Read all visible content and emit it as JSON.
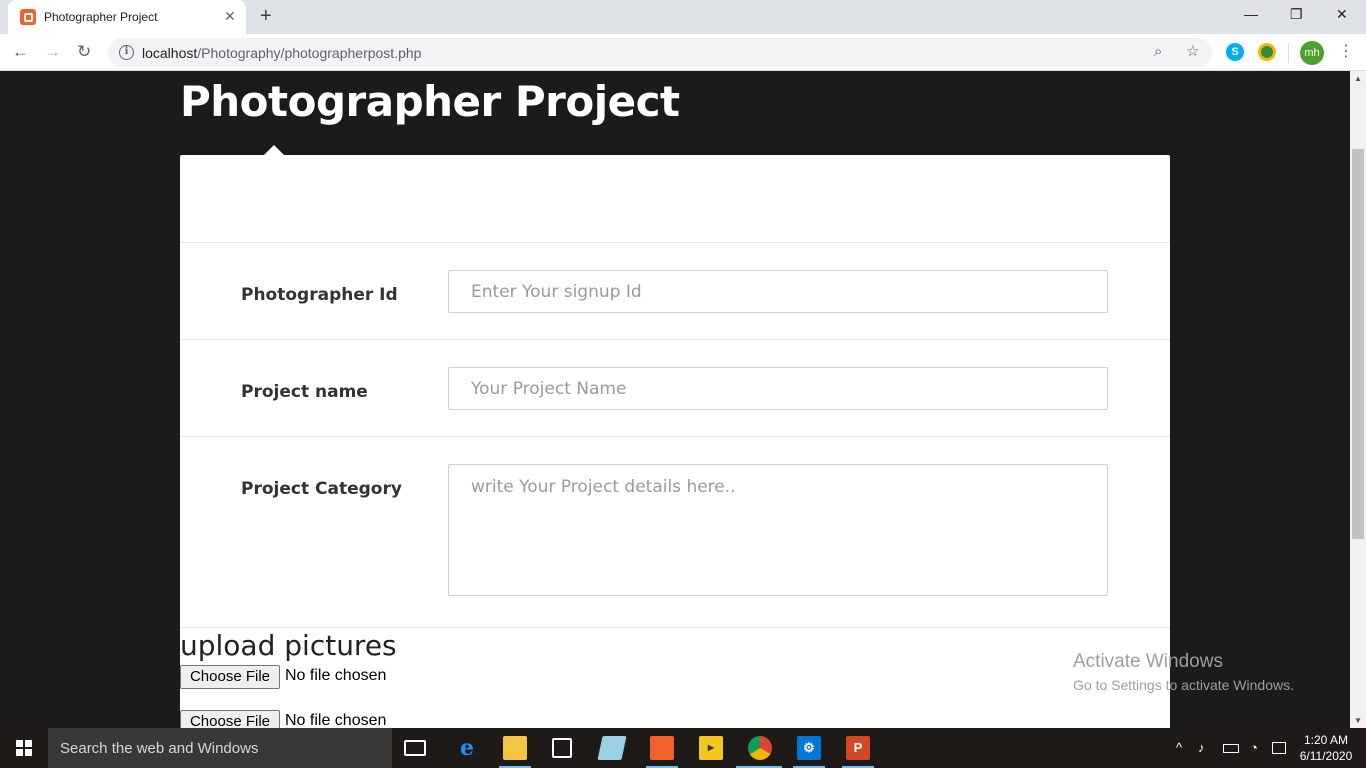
{
  "browser": {
    "tab_title": "Photographer Project",
    "tab_close": "✕",
    "new_tab": "+",
    "window_controls": {
      "minimize": "—",
      "restore": "❐",
      "close": "✕"
    },
    "nav": {
      "back": "←",
      "forward": "→",
      "reload": "↻"
    },
    "url_host": "localhost",
    "url_path": "/Photography/photographerpost.php",
    "profile_initials": "mh",
    "menu": "⋮",
    "zoom_icon": "⌕",
    "bookmark_icon": "☆",
    "skype_letter": "S"
  },
  "page": {
    "title": "Photographer Project",
    "fields": [
      {
        "label": "Photographer Id",
        "placeholder": "Enter Your signup Id",
        "value": ""
      },
      {
        "label": "Project name",
        "placeholder": "Your Project Name",
        "value": ""
      },
      {
        "label": "Project Category",
        "placeholder": "write Your Project details here..",
        "value": ""
      }
    ],
    "upload": {
      "heading": "upload pictures",
      "inputs": [
        {
          "button": "Choose File",
          "status": "No file chosen"
        },
        {
          "button": "Choose File",
          "status": "No file chosen"
        }
      ]
    }
  },
  "watermark": {
    "line1": "Activate Windows",
    "line2": "Go to Settings to activate Windows."
  },
  "taskbar": {
    "search_placeholder": "Search the web and Windows",
    "time": "1:20 AM",
    "date": "6/11/2020",
    "pinned_apps": [
      "task-view",
      "edge",
      "file-explorer",
      "store",
      "notepad",
      "xampp",
      "player",
      "chrome",
      "settings",
      "powerpoint"
    ]
  }
}
